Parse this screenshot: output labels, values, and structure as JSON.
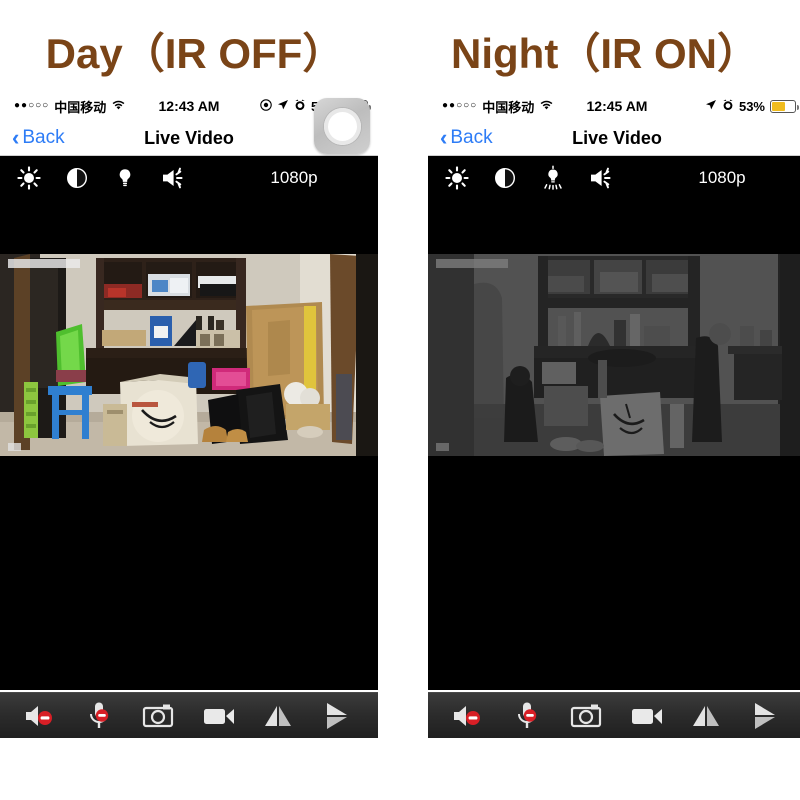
{
  "page": {
    "background": "#ffffff",
    "caption_color": "#7a4417"
  },
  "captions": {
    "left": "Day（IR OFF）",
    "right": "Night（IR ON）"
  },
  "panels": [
    {
      "id": "day",
      "mode": "IR OFF",
      "status_bar": {
        "signal_dots": "●●○○○",
        "carrier": "中国移动",
        "wifi_icon": "wifi-icon",
        "time": "12:43 AM",
        "icons": [
          "do-not-disturb-icon",
          "location-arrow-icon",
          "alarm-clock-icon"
        ],
        "battery_percent": "54%",
        "battery_level": 54,
        "battery_color": "#f0bc1e"
      },
      "nav_bar": {
        "back_label": "Back",
        "back_icon": "chevron-left-icon",
        "title": "Live Video",
        "camera_badge_icon": "camera-lens-icon",
        "camera_badge_visible": true,
        "tint_color": "#2d7cf6"
      },
      "control_bar": {
        "icons": [
          {
            "name": "brightness-sun-icon",
            "label": "Brightness"
          },
          {
            "name": "contrast-half-circle-icon",
            "label": "Contrast"
          },
          {
            "name": "saturation-bulb-icon",
            "label": "Saturation"
          },
          {
            "name": "ir-lamp-icon",
            "label": "IR Lamp"
          }
        ],
        "resolution": "1080p"
      },
      "video": {
        "type": "color-day",
        "timestamp_overlay": true,
        "letterbox": true
      },
      "bottom_bar": {
        "buttons": [
          {
            "name": "speaker-mute-button",
            "label": "Speaker Muted"
          },
          {
            "name": "mic-mute-button",
            "label": "Microphone Muted"
          },
          {
            "name": "snapshot-button",
            "label": "Snapshot"
          },
          {
            "name": "record-button",
            "label": "Record"
          },
          {
            "name": "mirror-button",
            "label": "Mirror"
          },
          {
            "name": "flip-button",
            "label": "Flip"
          }
        ]
      }
    },
    {
      "id": "night",
      "mode": "IR ON",
      "status_bar": {
        "signal_dots": "●●○○○",
        "carrier": "中国移动",
        "wifi_icon": "wifi-icon",
        "time": "12:45 AM",
        "icons": [
          "location-arrow-icon",
          "alarm-clock-icon"
        ],
        "battery_percent": "53%",
        "battery_level": 53,
        "battery_color": "#f0bc1e"
      },
      "nav_bar": {
        "back_label": "Back",
        "back_icon": "chevron-left-icon",
        "title": "Live Video",
        "camera_badge_icon": "camera-lens-icon",
        "camera_badge_visible": false,
        "tint_color": "#2d7cf6"
      },
      "control_bar": {
        "icons": [
          {
            "name": "brightness-sun-icon",
            "label": "Brightness"
          },
          {
            "name": "contrast-half-circle-icon",
            "label": "Contrast"
          },
          {
            "name": "saturation-bulb-glowing-icon",
            "label": "Saturation"
          },
          {
            "name": "ir-lamp-icon",
            "label": "IR Lamp"
          }
        ],
        "resolution": "1080p"
      },
      "video": {
        "type": "infrared-night",
        "timestamp_overlay": true,
        "letterbox": true
      },
      "bottom_bar": {
        "buttons": [
          {
            "name": "speaker-mute-button",
            "label": "Speaker Muted"
          },
          {
            "name": "mic-mute-button",
            "label": "Microphone Muted"
          },
          {
            "name": "snapshot-button",
            "label": "Snapshot"
          },
          {
            "name": "record-button",
            "label": "Record"
          },
          {
            "name": "mirror-button",
            "label": "Mirror"
          },
          {
            "name": "flip-button",
            "label": "Flip"
          }
        ]
      }
    }
  ]
}
